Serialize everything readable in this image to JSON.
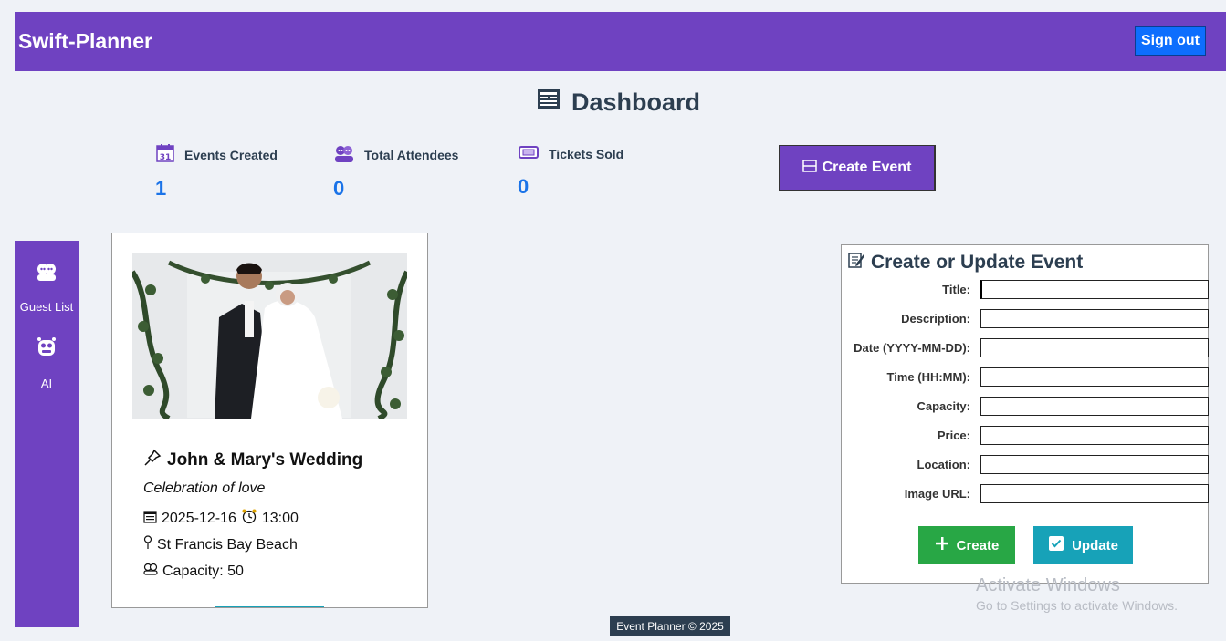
{
  "header": {
    "brand": "Swift-Planner",
    "signout_label": "Sign out"
  },
  "dashboard": {
    "title": "Dashboard"
  },
  "stats": [
    {
      "label": "Events Created",
      "value": "1",
      "icon": "calendar-icon"
    },
    {
      "label": "Total Attendees",
      "value": "0",
      "icon": "people-icon"
    },
    {
      "label": "Tickets Sold",
      "value": "0",
      "icon": "ticket-icon"
    }
  ],
  "create_event_button": {
    "label": "Create Event"
  },
  "sidebar": {
    "items": [
      {
        "label": "Guest List",
        "icon": "guests-icon"
      },
      {
        "label": "AI",
        "icon": "robot-icon"
      }
    ]
  },
  "event_card": {
    "title": "John & Mary's Wedding",
    "description": "Celebration of love",
    "date": "2025-12-16",
    "time": "13:00",
    "location": "St Francis Bay Beach",
    "capacity": "Capacity: 50"
  },
  "form": {
    "title": "Create or Update Event",
    "fields": [
      {
        "label": "Title:",
        "value": ""
      },
      {
        "label": "Description:",
        "value": ""
      },
      {
        "label": "Date (YYYY-MM-DD):",
        "value": ""
      },
      {
        "label": "Time (HH:MM):",
        "value": ""
      },
      {
        "label": "Capacity:",
        "value": ""
      },
      {
        "label": "Price:",
        "value": ""
      },
      {
        "label": "Location:",
        "value": ""
      },
      {
        "label": "Image URL:",
        "value": ""
      }
    ],
    "create_label": "Create",
    "update_label": "Update"
  },
  "watermark": {
    "line1": "Activate Windows",
    "line2": "Go to Settings to activate Windows."
  },
  "footer": {
    "text": "Event Planner © 2025"
  },
  "colors": {
    "primary": "#6f42c1",
    "signout": "#0d6efd",
    "create": "#28a745",
    "update": "#17a2b8",
    "stat_value": "#1a73e8"
  }
}
